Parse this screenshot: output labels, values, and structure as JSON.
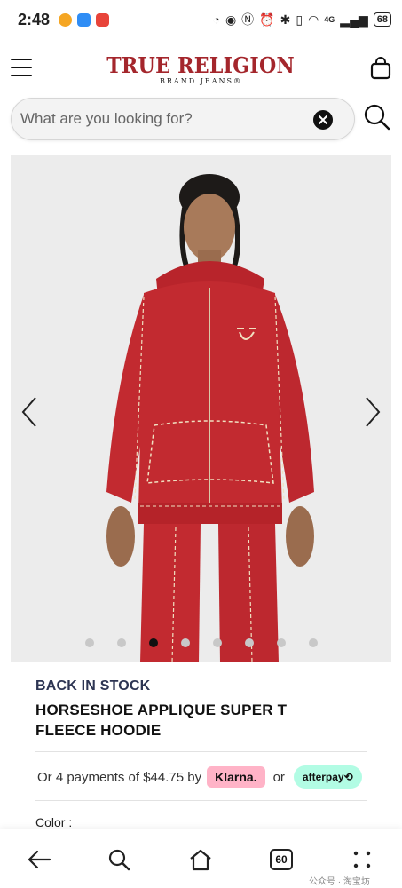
{
  "status_bar": {
    "time": "2:48",
    "network": "4G",
    "battery": "68"
  },
  "header": {
    "logo_main": "TRUE RELIGION",
    "logo_sub": "BRAND JEANS®",
    "brand_color": "#a4262c"
  },
  "search": {
    "placeholder": "What are you looking for?"
  },
  "gallery": {
    "image_count": 8,
    "active_index": 2
  },
  "product": {
    "stock_status": "BACK IN STOCK",
    "name": "HORSESHOE APPLIQUE SUPER T FLEECE HOODIE",
    "installment_text": "Or 4 payments of $44.75 by",
    "klarna_label": "Klarna.",
    "or_text": "or",
    "afterpay_label": "afterpay⟲",
    "color_label": "Color :",
    "product_color": "#c22a30",
    "stock_color": "#2d3553"
  },
  "bottom_nav": {
    "tab_count": "60",
    "watermark": "公众号 · 淘宝坊"
  },
  "icons": {
    "menu": "menu-icon",
    "bag": "shopping-bag-icon",
    "clear": "close-icon",
    "search": "search-icon",
    "prev": "chevron-left-icon",
    "next": "chevron-right-icon",
    "back": "back-arrow-icon",
    "home": "home-icon",
    "tabs": "tabs-icon",
    "more": "more-icon"
  }
}
